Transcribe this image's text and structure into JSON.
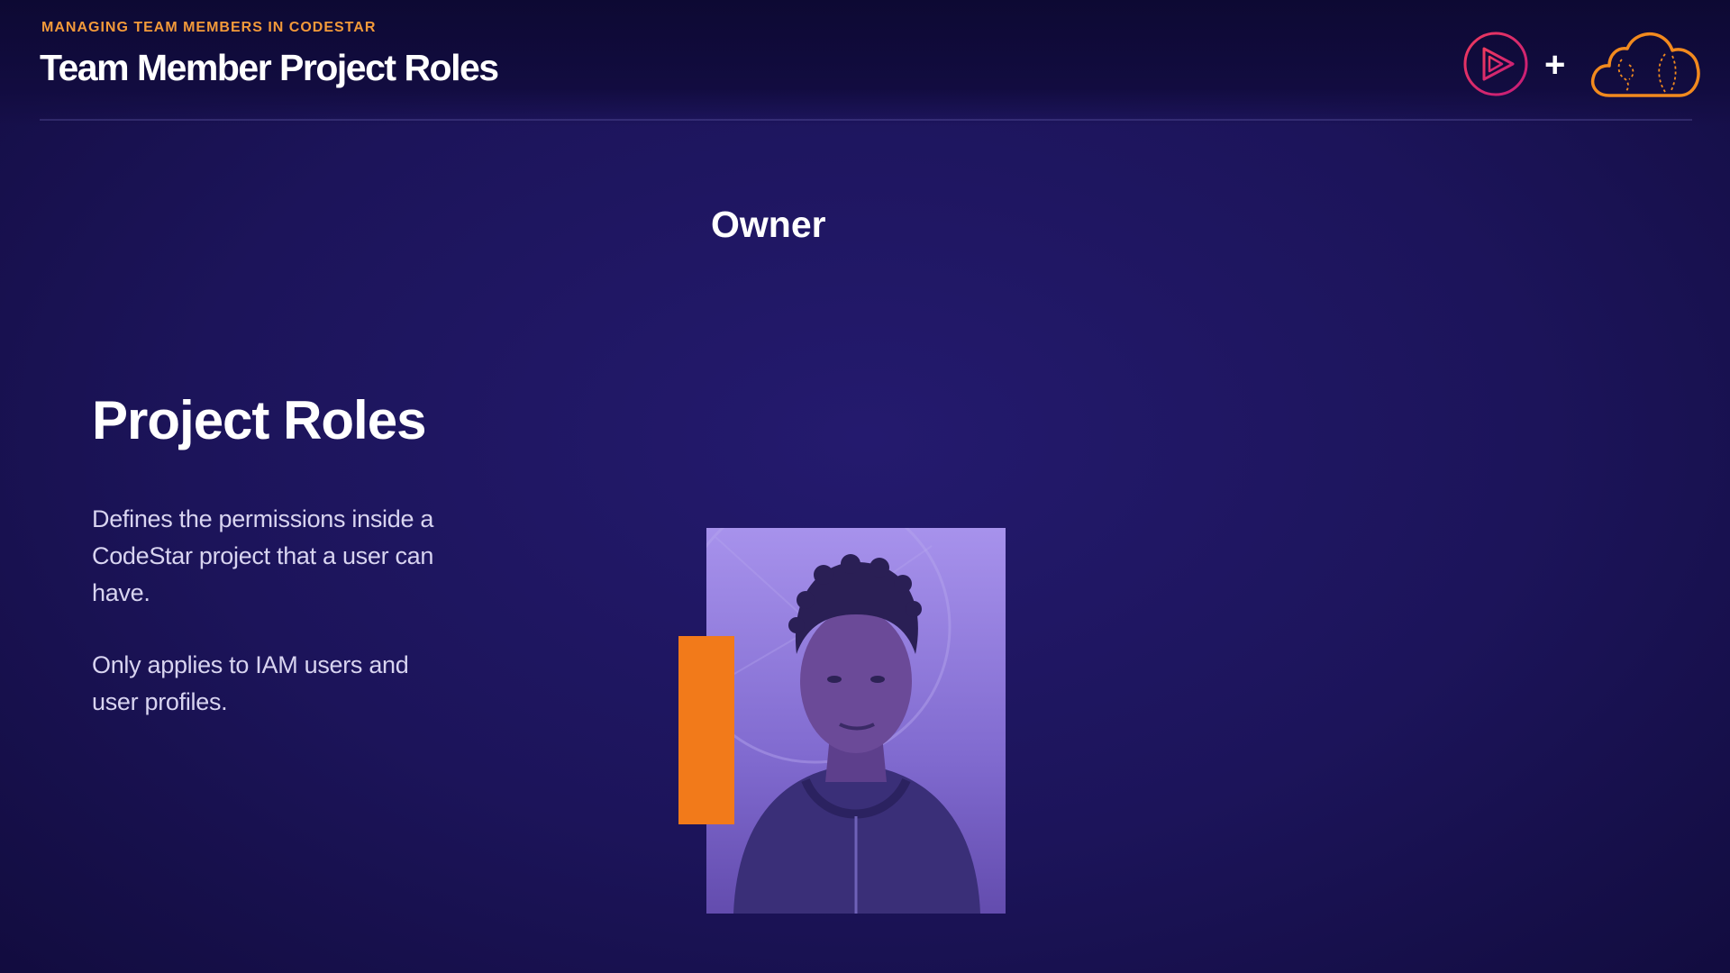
{
  "header": {
    "eyebrow": "MANAGING TEAM MEMBERS IN CODESTAR",
    "title": "Team Member Project Roles",
    "plus_symbol": "+",
    "logos": [
      "pluralsight-play-icon",
      "cloud-icon"
    ]
  },
  "slide": {
    "role_heading": "Owner",
    "section_heading": "Project Roles",
    "paragraphs": [
      "Defines the permissions inside a CodeStar project that a user can have.",
      "Only applies to IAM users and user profiles."
    ]
  },
  "colors": {
    "accent_orange": "#f27a1a",
    "eyebrow_orange": "#f39a3a",
    "play_logo_gradient": [
      "#e8245c",
      "#c01c7a"
    ],
    "background": "#1c145a",
    "photo_tint": "#8a72dc"
  }
}
